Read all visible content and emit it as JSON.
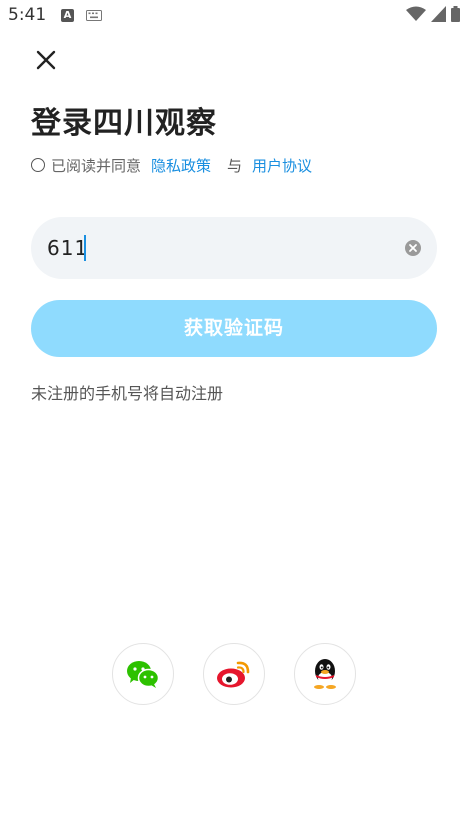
{
  "status_bar": {
    "time": "5:41",
    "a_label": "A",
    "icons": [
      "keyboard-icon",
      "wifi-icon",
      "signal-icon",
      "battery-icon"
    ]
  },
  "header": {
    "close_icon": "close-icon",
    "title": "登录四川观察"
  },
  "agreement": {
    "text": "已阅读并同意",
    "privacy_link": "隐私政策",
    "and": "与",
    "user_link": "用户协议"
  },
  "phone": {
    "value": "611",
    "clear_icon": "clear-icon"
  },
  "actions": {
    "get_code_label": "获取验证码"
  },
  "hint": "未注册的手机号将自动注册",
  "social": [
    "wechat-icon",
    "weibo-icon",
    "qq-icon"
  ],
  "colors": {
    "accent": "#1a8fe0",
    "button_disabled": "#8fdbfe",
    "input_bg": "#f1f4f7",
    "wechat_green": "#2dc100",
    "weibo_red": "#e6162d"
  }
}
